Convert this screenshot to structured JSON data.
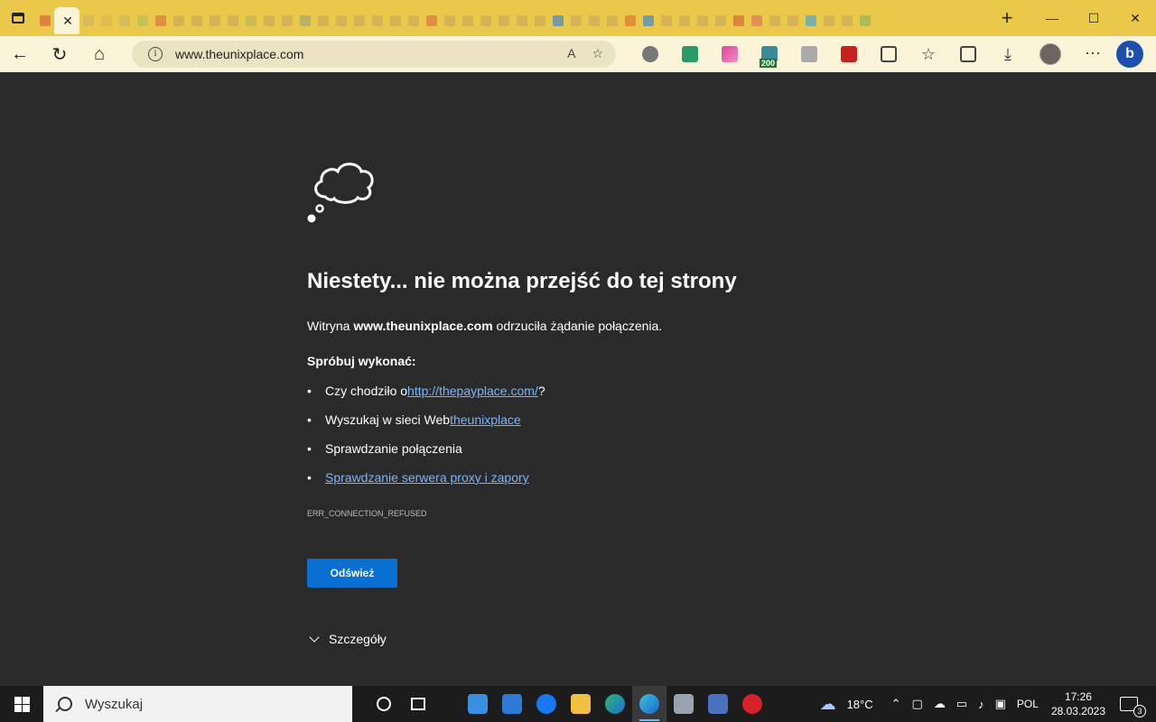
{
  "browser": {
    "url": "www.theunixplace.com",
    "tab_favicon_colors": [
      "#d94a3a",
      "#c8b36a",
      "#c8b36a",
      "#d8b05a",
      "#c8b36a",
      "#a0c060",
      "#d96040",
      "#c8a060",
      "#c8a060",
      "#c8a060",
      "#c8a060",
      "#b0b060",
      "#c8a060",
      "#c8a060",
      "#90a080",
      "#c8a060",
      "#c8a060",
      "#c8a060",
      "#c8a060",
      "#c8a060",
      "#c8a060",
      "#d96040",
      "#c8a060",
      "#c8a060",
      "#c8a060",
      "#c8a060",
      "#c8a060",
      "#c8a060",
      "#1877f2",
      "#c8a060",
      "#c8a060",
      "#c8a060",
      "#e06030",
      "#1877f2",
      "#c8a060",
      "#c8a060",
      "#c8a060",
      "#c8a060",
      "#d94a3a",
      "#e06060",
      "#c8a060",
      "#c8a060",
      "#1da1f2",
      "#c8a060",
      "#c8a060",
      "#7ab060"
    ]
  },
  "page": {
    "heading": "Niestety... nie można przejść do tej strony",
    "line_prefix": "Witryna ",
    "line_host": "www.theunixplace.com",
    "line_suffix": " odrzuciła żądanie połączenia.",
    "try_label": "Spróbuj wykonać:",
    "suggestion1_prefix": "Czy chodziło o ",
    "suggestion1_link": "http://thepayplace.com/",
    "suggestion1_suffix": "?",
    "suggestion2_prefix": "Wyszukaj w sieci Web ",
    "suggestion2_link": "theunixplace",
    "suggestion3": "Sprawdzanie połączenia",
    "suggestion4_link": "Sprawdzanie serwera proxy i zapory",
    "error_code": "ERR_CONNECTION_REFUSED",
    "refresh_label": "Odśwież",
    "details_label": "Szczegóły"
  },
  "toolbar": {
    "badge_200": "200"
  },
  "taskbar": {
    "search_placeholder": "Wyszukaj",
    "temperature": "18°C",
    "language": "POL",
    "time": "17:26",
    "date": "28.03.2023",
    "notification_count": "3"
  }
}
